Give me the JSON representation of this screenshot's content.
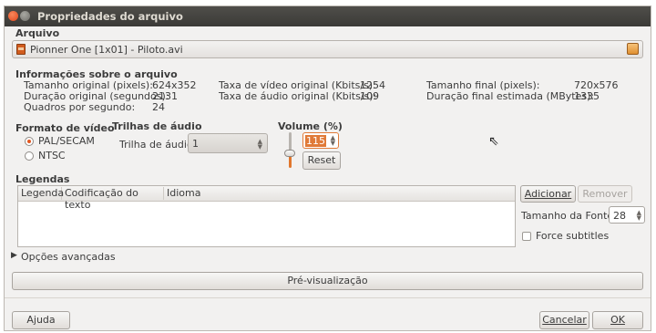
{
  "window": {
    "title": "Propriedades do arquivo"
  },
  "arquivo": {
    "label": "Arquivo",
    "file_name": "Pionner One [1x01] - Piloto.avi",
    "file_icon": "video-file-icon",
    "open_icon": "open-folder-icon"
  },
  "info": {
    "heading": "Informações sobre o arquivo",
    "col1": [
      {
        "label": "Tamanho original (pixels):",
        "value": "624x352"
      },
      {
        "label": "Duração original (segundos):",
        "value": "2131"
      },
      {
        "label": "Quadros por segundo:",
        "value": "24"
      }
    ],
    "col2": [
      {
        "label": "Taxa de vídeo original (Kbits/s):",
        "value": "1254"
      },
      {
        "label": "Taxa de áudio original (Kbits/s):",
        "value": "109"
      }
    ],
    "col3": [
      {
        "label": "Tamanho final (pixels):",
        "value": "720x576"
      },
      {
        "label": "Duração final estimada (MBytes):",
        "value": "1335"
      }
    ]
  },
  "video_format": {
    "heading": "Formato de vídeo",
    "options": [
      {
        "label": "PAL/SECAM",
        "selected": true
      },
      {
        "label": "NTSC",
        "selected": false
      }
    ]
  },
  "audio_tracks": {
    "heading": "Trilhas de áudio",
    "track_label": "Trilha de áudio:",
    "track_value": "1"
  },
  "volume": {
    "heading": "Volume (%)",
    "value": "115",
    "reset_label": "Reset",
    "level_fraction": 0.35
  },
  "legendas": {
    "heading": "Legendas",
    "columns": [
      "Legenda",
      "Codificação do texto",
      "Idioma"
    ],
    "add_label": "Adicionar",
    "remove_label": "Remover",
    "font_size_label": "Tamanho da Fonte:",
    "font_size_value": "28",
    "force_label": "Force subtitles"
  },
  "advanced": {
    "label": "Opções avançadas"
  },
  "preview_label": "Pré-visualização",
  "footer": {
    "help_label": "Ajuda",
    "cancel_label": "Cancelar",
    "ok_label": "OK"
  },
  "colors": {
    "accent": "#e25620",
    "titlebar": "#3c3b37"
  }
}
